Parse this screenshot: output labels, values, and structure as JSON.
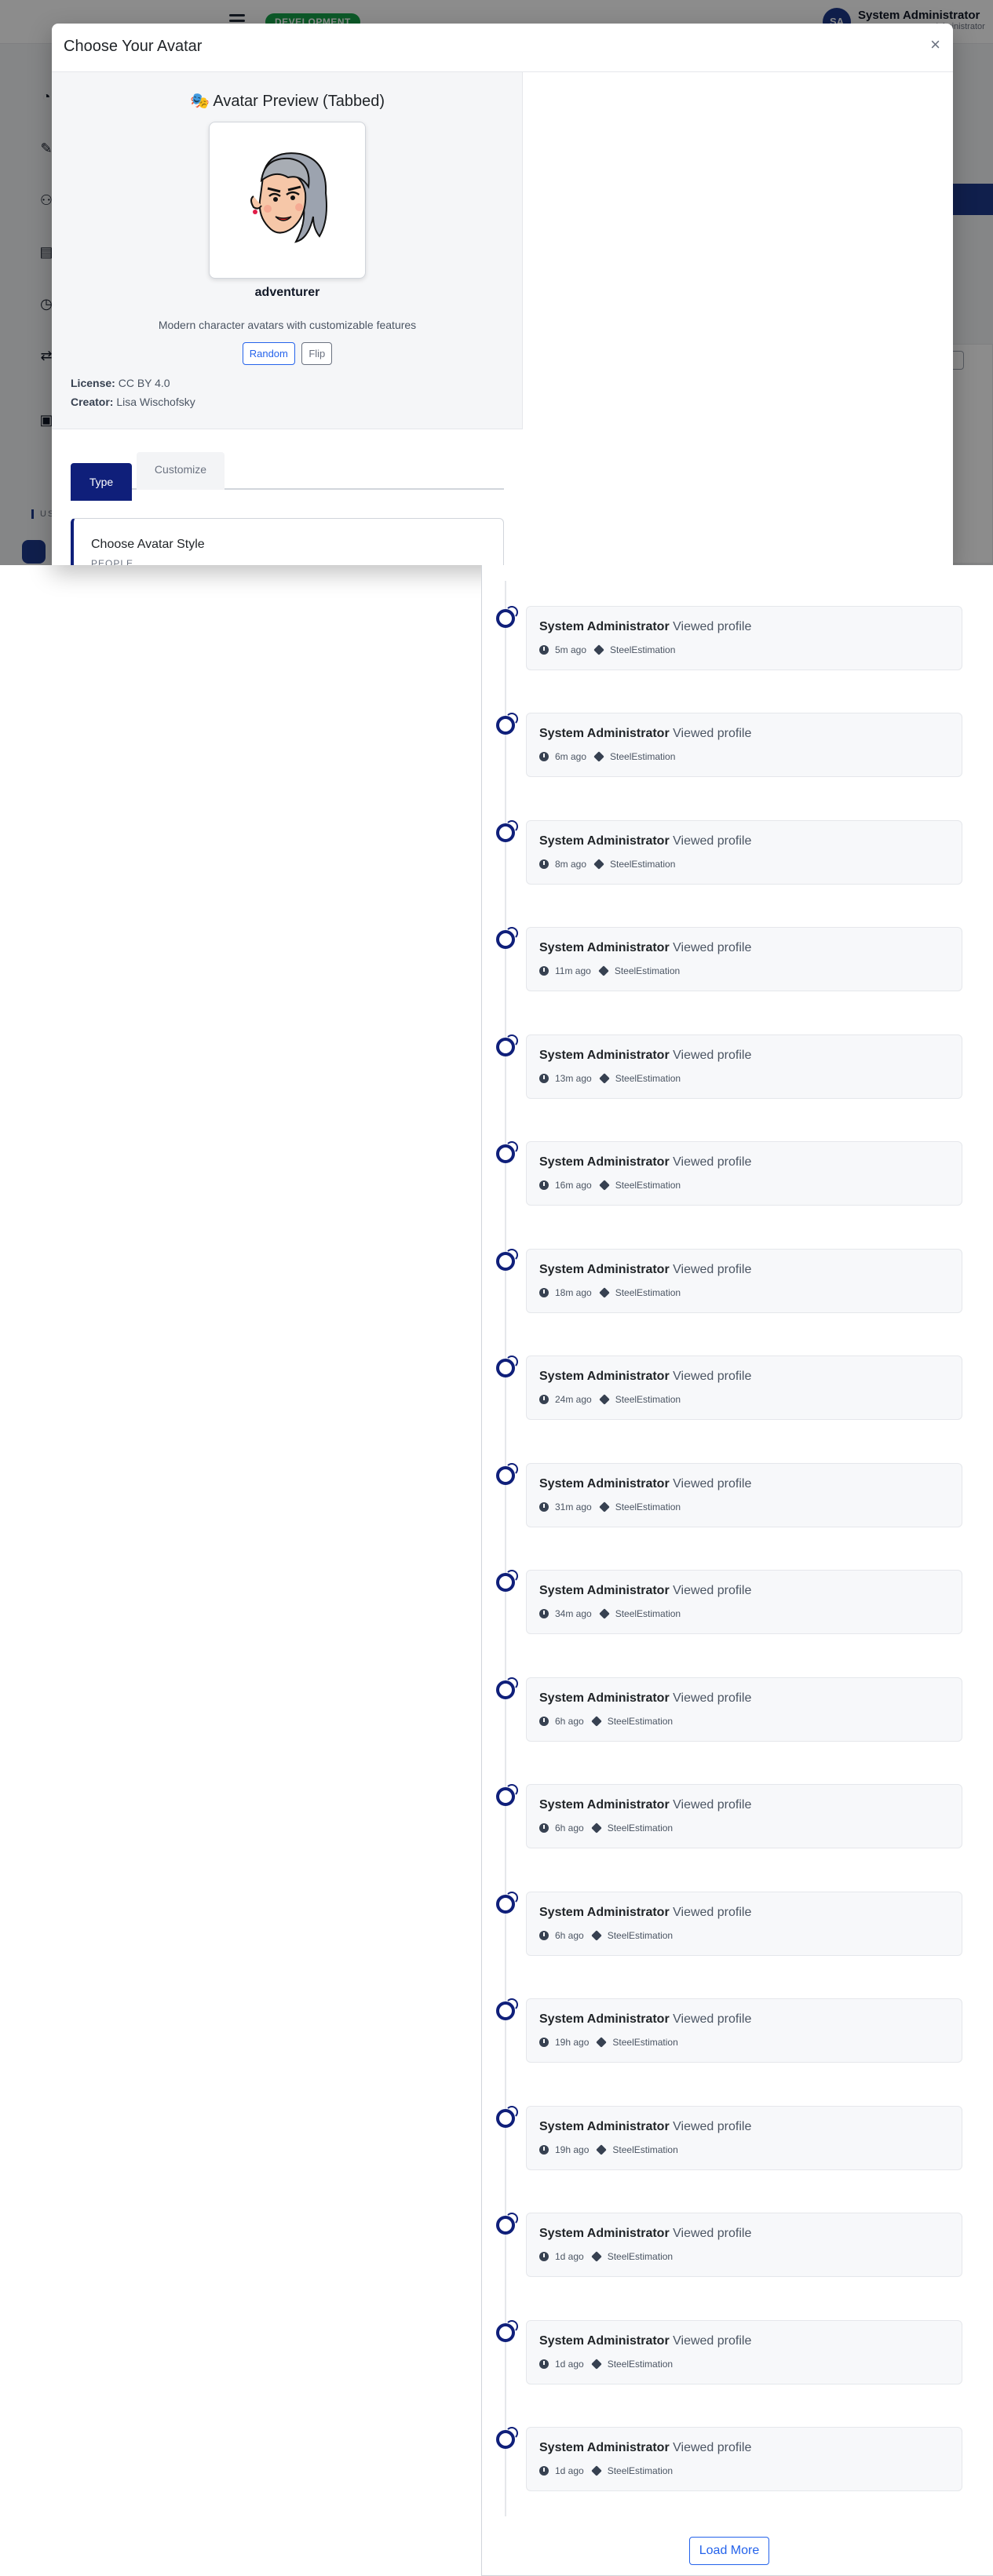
{
  "app": {
    "env_badge": "DEVELOPMENT",
    "user_initials": "SA",
    "user_name": "System Administrator",
    "user_role": "Administrator",
    "sidebar_section_label": "USER"
  },
  "modal": {
    "title": "Choose Your Avatar",
    "close_symbol": "×",
    "preview_heading": "🎭 Avatar Preview (Tabbed)",
    "avatar_name": "adventurer",
    "avatar_description": "Modern character avatars with customizable features",
    "buttons": {
      "random": "Random",
      "flip": "Flip"
    },
    "license_label": "License:",
    "license_value": "CC BY 4.0",
    "creator_label": "Creator:",
    "creator_value": "Lisa Wischofsky",
    "tabs": [
      "Type",
      "Customize"
    ],
    "active_tab": "Type",
    "style_card_title": "Choose Avatar Style",
    "style_card_subtitle": "PEOPLE"
  },
  "activity": {
    "items": [
      {
        "user": "System Administrator",
        "action": "Viewed profile",
        "time": "5m ago",
        "app": "SteelEstimation"
      },
      {
        "user": "System Administrator",
        "action": "Viewed profile",
        "time": "6m ago",
        "app": "SteelEstimation"
      },
      {
        "user": "System Administrator",
        "action": "Viewed profile",
        "time": "8m ago",
        "app": "SteelEstimation"
      },
      {
        "user": "System Administrator",
        "action": "Viewed profile",
        "time": "11m ago",
        "app": "SteelEstimation"
      },
      {
        "user": "System Administrator",
        "action": "Viewed profile",
        "time": "13m ago",
        "app": "SteelEstimation"
      },
      {
        "user": "System Administrator",
        "action": "Viewed profile",
        "time": "16m ago",
        "app": "SteelEstimation"
      },
      {
        "user": "System Administrator",
        "action": "Viewed profile",
        "time": "18m ago",
        "app": "SteelEstimation"
      },
      {
        "user": "System Administrator",
        "action": "Viewed profile",
        "time": "24m ago",
        "app": "SteelEstimation"
      },
      {
        "user": "System Administrator",
        "action": "Viewed profile",
        "time": "31m ago",
        "app": "SteelEstimation"
      },
      {
        "user": "System Administrator",
        "action": "Viewed profile",
        "time": "34m ago",
        "app": "SteelEstimation"
      },
      {
        "user": "System Administrator",
        "action": "Viewed profile",
        "time": "6h ago",
        "app": "SteelEstimation"
      },
      {
        "user": "System Administrator",
        "action": "Viewed profile",
        "time": "6h ago",
        "app": "SteelEstimation"
      },
      {
        "user": "System Administrator",
        "action": "Viewed profile",
        "time": "6h ago",
        "app": "SteelEstimation"
      },
      {
        "user": "System Administrator",
        "action": "Viewed profile",
        "time": "19h ago",
        "app": "SteelEstimation"
      },
      {
        "user": "System Administrator",
        "action": "Viewed profile",
        "time": "19h ago",
        "app": "SteelEstimation"
      },
      {
        "user": "System Administrator",
        "action": "Viewed profile",
        "time": "1d ago",
        "app": "SteelEstimation"
      },
      {
        "user": "System Administrator",
        "action": "Viewed profile",
        "time": "1d ago",
        "app": "SteelEstimation"
      },
      {
        "user": "System Administrator",
        "action": "Viewed profile",
        "time": "1d ago",
        "app": "SteelEstimation"
      }
    ],
    "load_more_label": "Load More"
  },
  "colors": {
    "brand_navy": "#0f1f7a",
    "link_blue": "#2563eb",
    "env_green": "#16a34a"
  },
  "icons": {
    "activity_icon": "view-profile-icon",
    "time_icon": "clock-icon",
    "app_icon": "cube-icon"
  }
}
